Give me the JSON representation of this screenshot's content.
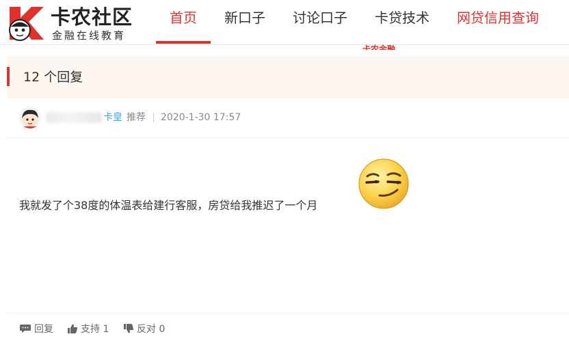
{
  "header": {
    "logo_title": "卡农社区",
    "logo_subtitle": "金融在线教育",
    "nav": [
      {
        "label": "首页"
      },
      {
        "label": "新口子"
      },
      {
        "label": "讨论口子"
      },
      {
        "label": "卡贷技术"
      },
      {
        "label": "网贷信用查询"
      }
    ],
    "clipped_text": "卡农金融"
  },
  "reply_bar": {
    "count_label": "12 个回复"
  },
  "post": {
    "author_tag": "卡皇",
    "recommend": "推荐",
    "timestamp": "2020-1-30 17:57",
    "content": "我就发了个38度的体温表给建行客服，房贷给我推迟了一个月"
  },
  "actions": {
    "reply": "回复",
    "support": "支持 1",
    "oppose": "反对 0"
  },
  "colors": {
    "accent": "#e0312f",
    "link_blue": "#3aa3e0",
    "reply_bar_bg": "#fdf6f0"
  },
  "icons": [
    "logo-mark",
    "avatar",
    "emoji-smirk",
    "comment-icon",
    "thumbs-up-icon",
    "thumbs-down-icon"
  ]
}
